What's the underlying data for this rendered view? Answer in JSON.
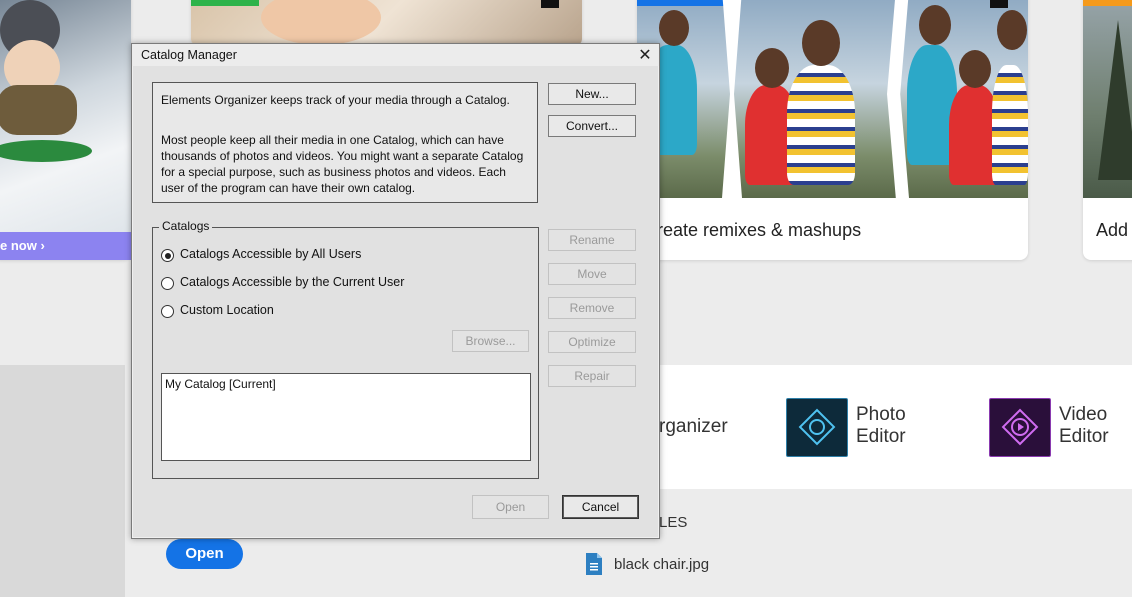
{
  "background": {
    "promo_link": "e now ›",
    "cards": [
      {
        "title": "reate remixes & mashups"
      },
      {
        "title": "Add"
      }
    ],
    "apps": [
      {
        "label": "rganizer"
      },
      {
        "label_line1": "Photo",
        "label_line2": "Editor",
        "color": "#0d2a3a"
      },
      {
        "label_line1": "Video",
        "label_line2": "Editor",
        "color": "#2a0f3a"
      }
    ],
    "files_heading": "LES",
    "open_button": "Open",
    "recent_file": "black chair.jpg",
    "accent_color": "#1473e6",
    "promo_color": "#8c83f0"
  },
  "dialog": {
    "title": "Catalog Manager",
    "close": "✕",
    "info_paragraph_1": "Elements Organizer keeps track of your media through a Catalog.",
    "info_paragraph_2": "Most people keep all their media in one Catalog, which can have thousands of photos and videos. You might want a separate Catalog for a special purpose, such as business photos and videos. Each user of the program can have their own catalog.",
    "buttons": {
      "new": "New...",
      "convert": "Convert...",
      "rename": "Rename",
      "move": "Move",
      "remove": "Remove",
      "optimize": "Optimize",
      "repair": "Repair",
      "browse": "Browse...",
      "open": "Open",
      "cancel": "Cancel"
    },
    "catalogs_group": {
      "legend": "Catalogs",
      "options": [
        {
          "label": "Catalogs Accessible by All Users",
          "checked": true
        },
        {
          "label": "Catalogs Accessible by the Current User",
          "checked": false
        },
        {
          "label": "Custom Location",
          "checked": false
        }
      ],
      "list_items": [
        "My Catalog [Current]"
      ]
    }
  }
}
